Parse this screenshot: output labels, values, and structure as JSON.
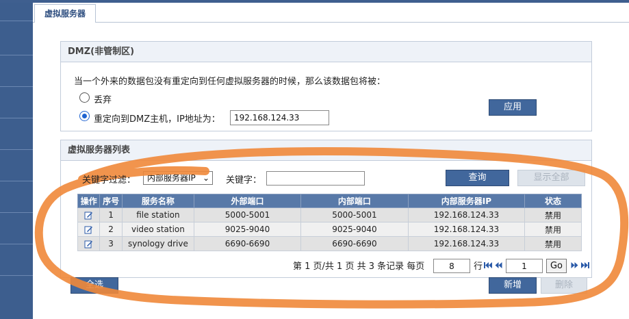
{
  "tab": {
    "label": "虚拟服务器"
  },
  "dmz": {
    "title": "DMZ(非管制区)",
    "description": "当一个外来的数据包没有重定向到任何虚拟服务器的时候，那么该数据包将被：",
    "option_drop": "丢弃",
    "option_redirect": "重定向到DMZ主机，IP地址为：",
    "selected": "redirect",
    "ip_value": "192.168.124.33",
    "apply_label": "应用"
  },
  "vs": {
    "title": "虚拟服务器列表",
    "filter_label": "关键字过滤：",
    "filter_select": "内部服务器IP",
    "keyword_label": "关键字：",
    "keyword_value": "",
    "query_label": "查询",
    "show_all_label": "显示全部",
    "columns": [
      "操作",
      "序号",
      "服务名称",
      "外部端口",
      "内部端口",
      "内部服务器IP",
      "状态"
    ],
    "rows": [
      {
        "index": "1",
        "name": "file station",
        "ext_port": "5000-5001",
        "int_port": "5000-5001",
        "ip": "192.168.124.33",
        "status": "禁用"
      },
      {
        "index": "2",
        "name": "video station",
        "ext_port": "9025-9040",
        "int_port": "9025-9040",
        "ip": "192.168.124.33",
        "status": "禁用"
      },
      {
        "index": "3",
        "name": "synology drive",
        "ext_port": "6690-6690",
        "int_port": "6690-6690",
        "ip": "192.168.124.33",
        "status": "禁用"
      }
    ],
    "pager": {
      "summary": "第 1 页/共 1 页 共 3 条记录 每页",
      "per_page": "8",
      "rows_unit": "行",
      "page_value": "1",
      "go_label": "Go"
    },
    "select_all_label": "全选",
    "add_label": "新增",
    "delete_label": "删除"
  },
  "colors": {
    "accent": "#41679c",
    "header": "#5879a8",
    "annotation": "#f0883a"
  }
}
